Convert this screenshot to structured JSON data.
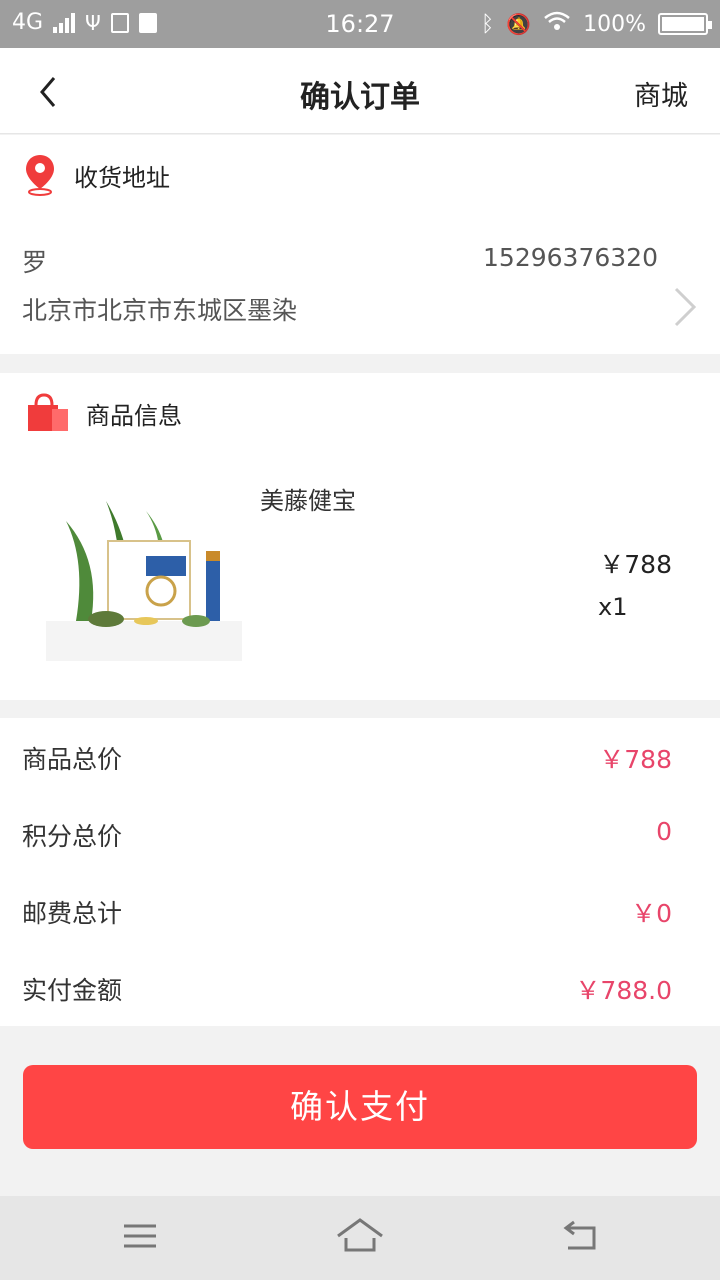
{
  "status_bar": {
    "network": "4G",
    "time": "16:27",
    "battery": "100%"
  },
  "header": {
    "title": "确认订单",
    "right_link": "商城"
  },
  "address": {
    "section_title": "收货地址",
    "name": "罗",
    "phone": "15296376320",
    "detail": "北京市北京市东城区墨染"
  },
  "goods": {
    "section_title": "商品信息",
    "items": [
      {
        "name": "美藤健宝",
        "price": "￥788",
        "qty": "x1"
      }
    ]
  },
  "summary": {
    "rows": [
      {
        "label": "商品总价",
        "value": "￥788"
      },
      {
        "label": "积分总价",
        "value": "0"
      },
      {
        "label": "邮费总计",
        "value": "￥0"
      },
      {
        "label": "实付金额",
        "value": "￥788.0"
      }
    ]
  },
  "actions": {
    "pay_label": "确认支付"
  },
  "colors": {
    "accent": "#ff4545",
    "price": "#e8456a"
  }
}
